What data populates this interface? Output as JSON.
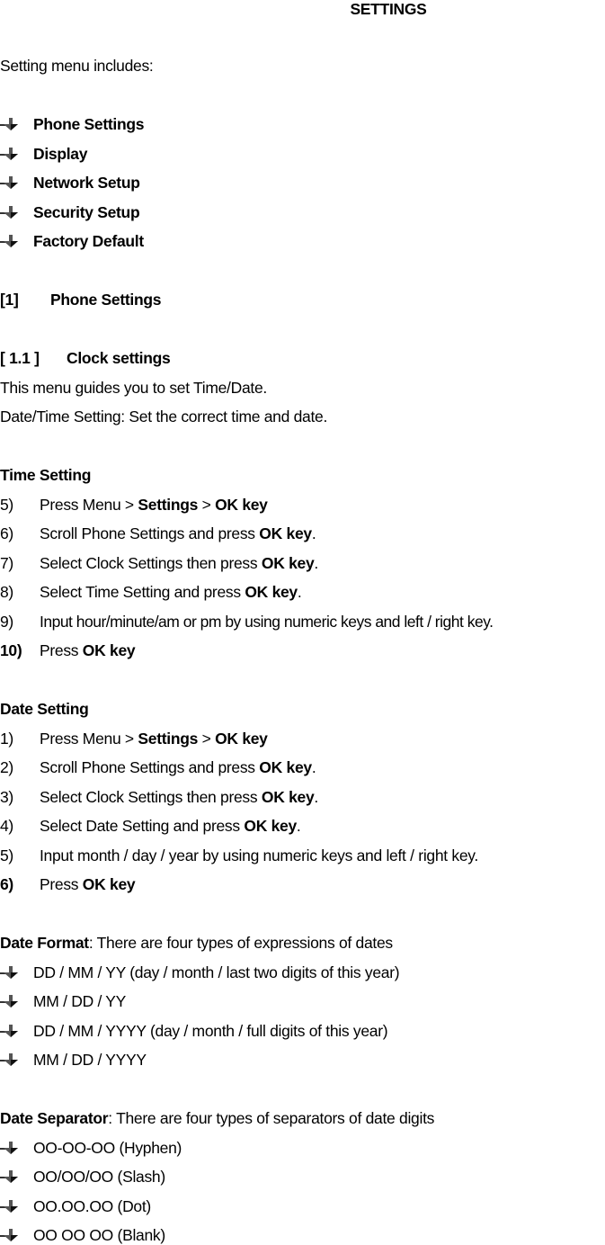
{
  "title": "SETTINGS",
  "intro": "Setting menu includes:",
  "menu_items": [
    "Phone Settings",
    "Display",
    "Network Setup",
    "Security Setup",
    "Factory Default"
  ],
  "section1": {
    "number": "[1]",
    "title": "Phone Settings"
  },
  "section11": {
    "number": "[ 1.1 ]",
    "title": "Clock settings",
    "desc1": "This menu guides you to set Time/Date.",
    "desc2": "Date/Time Setting: Set the correct time and date."
  },
  "time_setting": {
    "heading": "Time Setting",
    "steps": [
      {
        "num": "5)",
        "pre": "Press Menu > ",
        "b1": "Settings",
        "mid": " > ",
        "b2": "OK key",
        "post": ""
      },
      {
        "num": "6)",
        "pre": "Scroll Phone Settings and press ",
        "b1": "OK key",
        "post": "."
      },
      {
        "num": "7)",
        "pre": "Select Clock Settings then press ",
        "b1": "OK key",
        "post": "."
      },
      {
        "num": "8)",
        "pre": "Select Time Setting and press ",
        "b1": "OK key",
        "post": "."
      },
      {
        "num": "9)",
        "pre": "Input hour/minute/am or pm by using numeric keys and left / right key."
      },
      {
        "num": "10)",
        "pre": "Press ",
        "b1": "OK key"
      }
    ]
  },
  "date_setting": {
    "heading": "Date Setting",
    "steps": [
      {
        "num": "1)",
        "pre": "Press Menu > ",
        "b1": "Settings",
        "mid": " > ",
        "b2": "OK key"
      },
      {
        "num": "2)",
        "pre": "Scroll Phone Settings and press ",
        "b1": "OK key",
        "post": "."
      },
      {
        "num": "3)",
        "pre": "Select Clock Settings then press ",
        "b1": "OK key",
        "post": "."
      },
      {
        "num": "4)",
        "pre": "Select Date Setting and press ",
        "b1": "OK key",
        "post": "."
      },
      {
        "num": "5)",
        "pre": "Input month / day / year by using numeric keys and left / right key."
      },
      {
        "num": "6)",
        "pre": "Press ",
        "b1": "OK key"
      }
    ]
  },
  "date_format": {
    "label": "Date Format",
    "text": ": There are four types of expressions of dates",
    "items": [
      "DD / MM / YY (day / month / last two digits of this year)",
      "MM / DD / YY",
      "DD / MM / YYYY (day / month / full digits of this year)",
      "MM / DD / YYYY"
    ]
  },
  "date_separator": {
    "label": "Date Separator",
    "text": ": There are four types of separators of date digits",
    "items": [
      "OO-OO-OO (Hyphen)",
      "OO/OO/OO (Slash)",
      "OO.OO.OO (Dot)",
      "OO OO OO (Blank)"
    ]
  }
}
